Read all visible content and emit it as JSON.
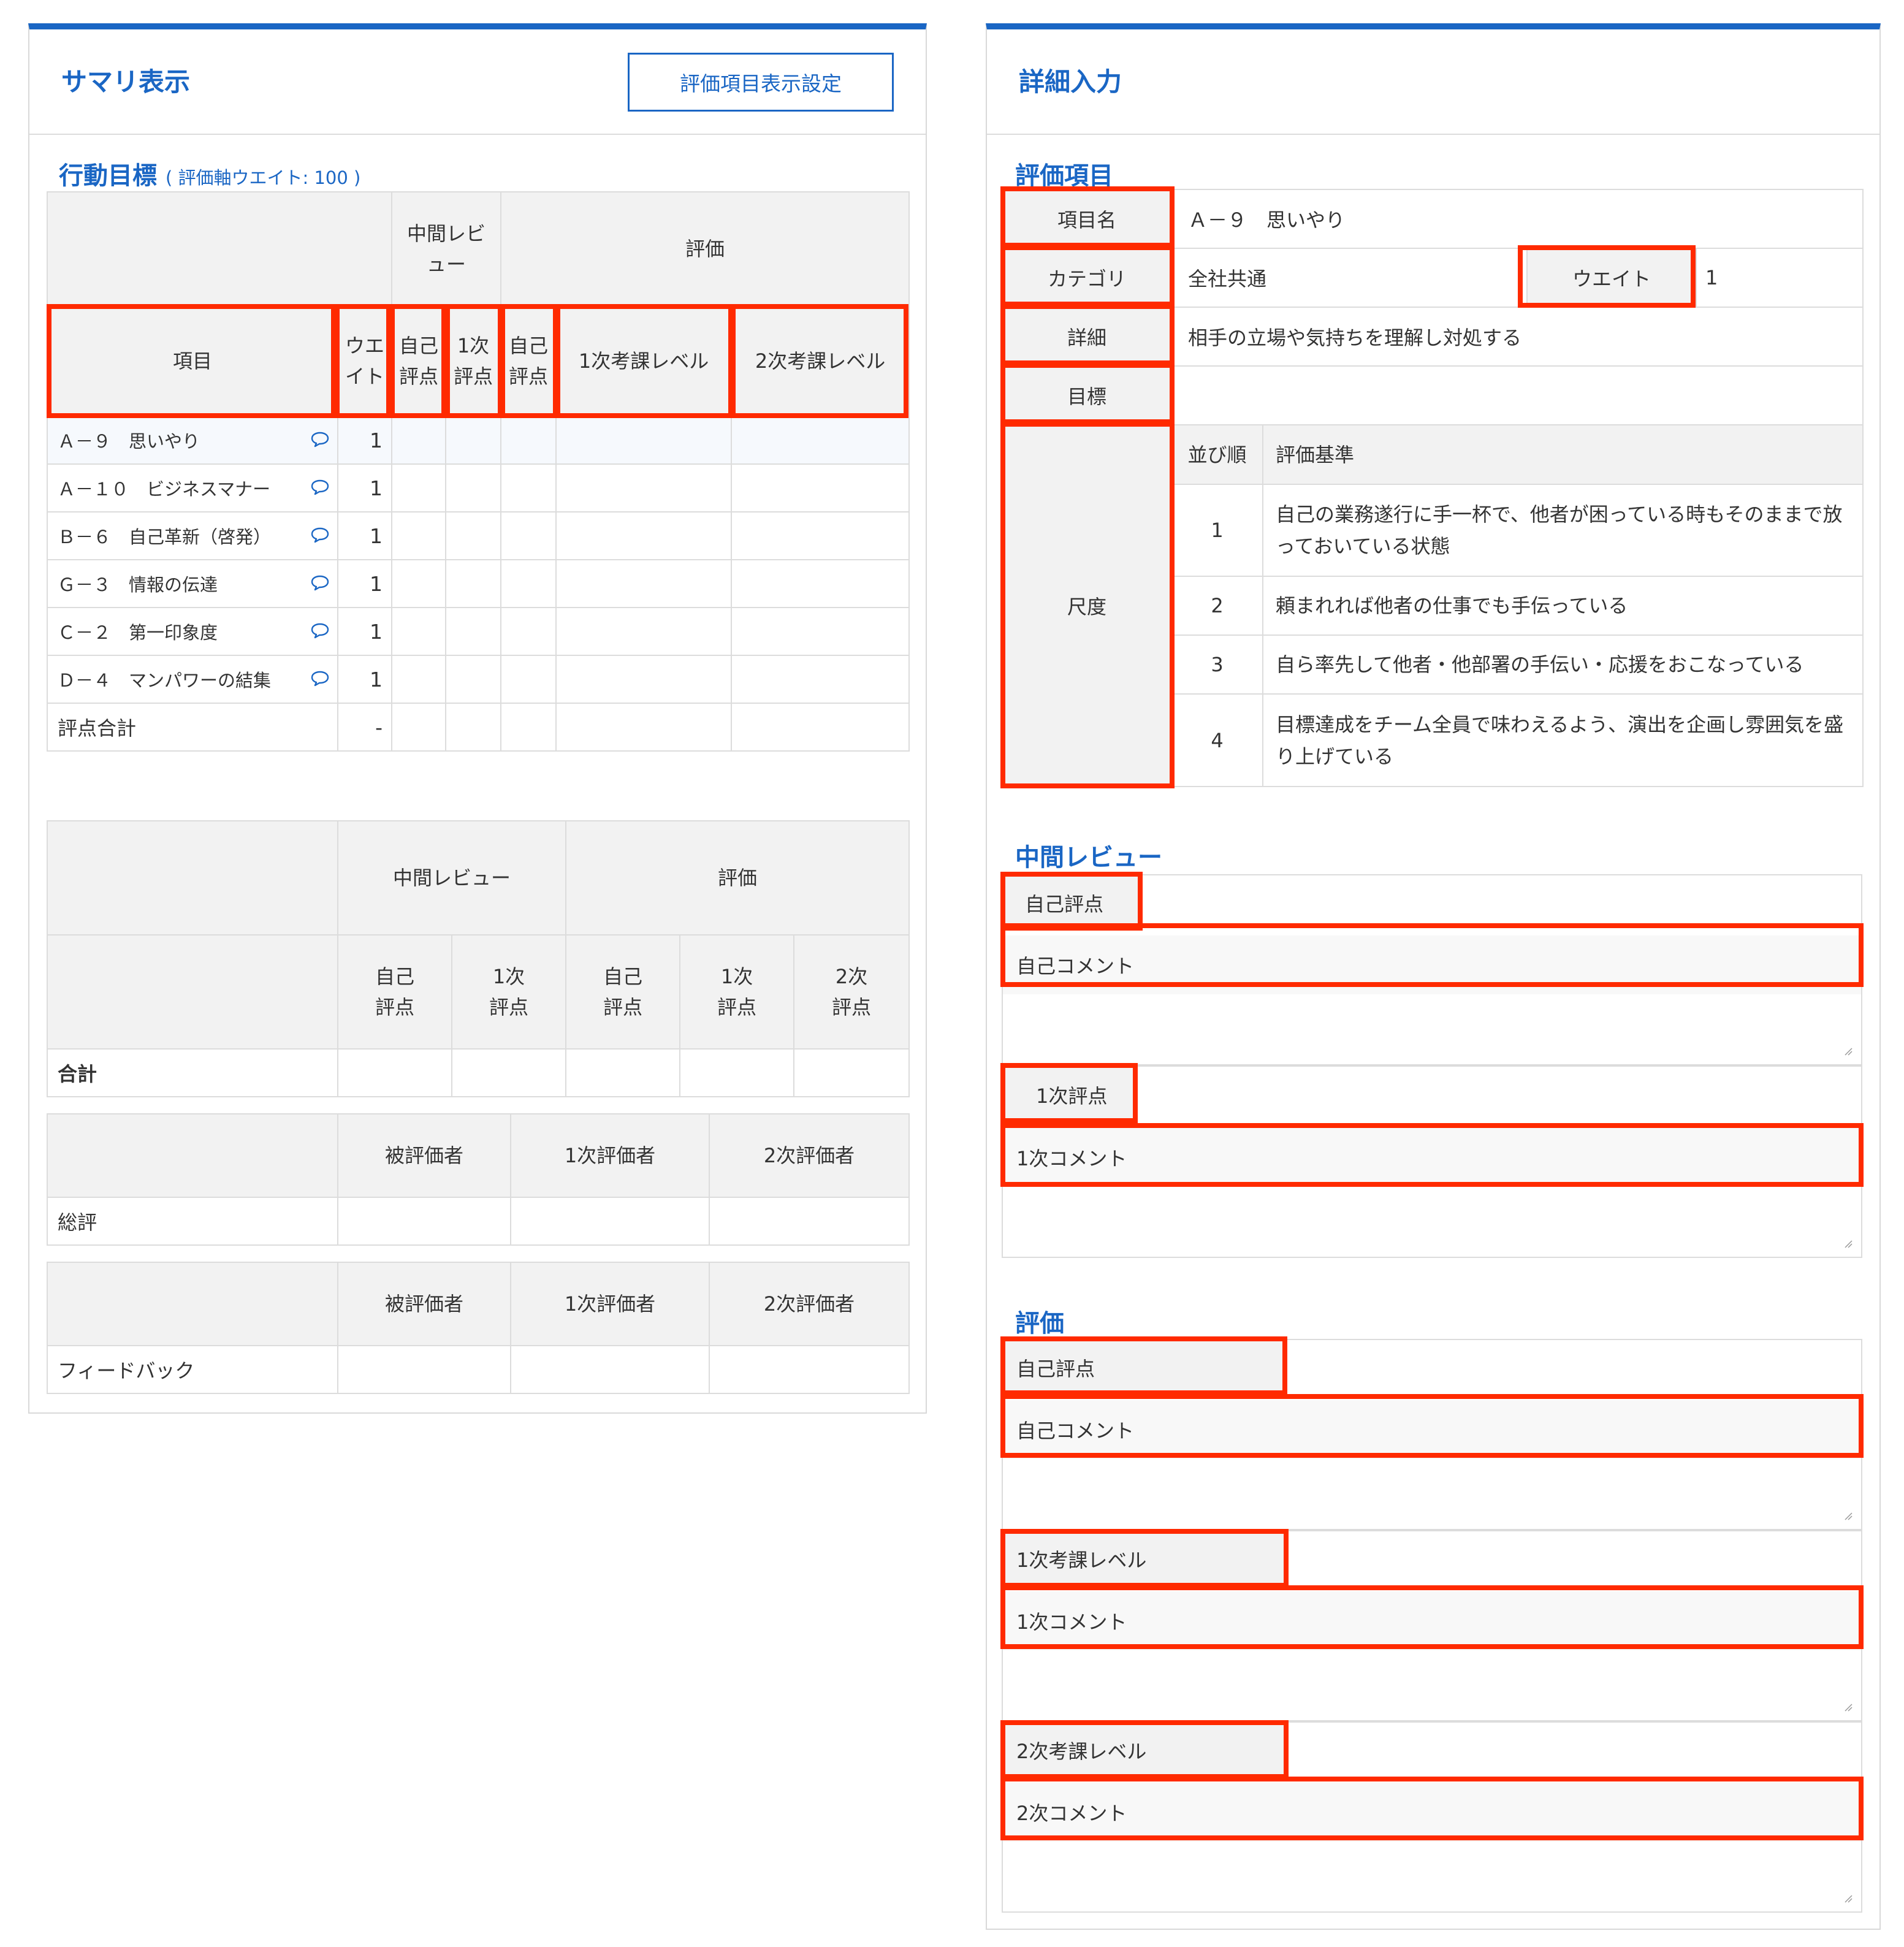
{
  "summary": {
    "title": "サマリ表示",
    "settings_button": "評価項目表示設定",
    "section_title": "行動目標",
    "section_weight": "( 評価軸ウエイト: 100 )",
    "table1": {
      "group_mid": "中間レビュー",
      "group_eval": "評価",
      "col_item": "項目",
      "col_weight": "ウエイト",
      "col_mid_self": "自己評点",
      "col_mid_first": "1次評点",
      "col_eval_self": "自己評点",
      "col_eval_first": "1次考課レベル",
      "col_eval_second": "2次考課レベル",
      "rows": [
        {
          "name": "Ａ－９　思いやり",
          "weight": "1"
        },
        {
          "name": "Ａ－１０　ビジネスマナー",
          "weight": "1"
        },
        {
          "name": "Ｂ－６　自己革新（啓発）",
          "weight": "1"
        },
        {
          "name": "Ｇ－３　情報の伝達",
          "weight": "1"
        },
        {
          "name": "Ｃ－２　第一印象度",
          "weight": "1"
        },
        {
          "name": "Ｄ－４　マンパワーの結集",
          "weight": "1"
        }
      ],
      "total_label": "評点合計",
      "total_value": "-"
    },
    "table2": {
      "group_mid": "中間レビュー",
      "group_eval": "評価",
      "col_mid_self": "自己評点",
      "col_mid_first": "1次評点",
      "col_eval_self": "自己評点",
      "col_eval_first": "1次評点",
      "col_eval_second": "2次評点",
      "total_label": "合計"
    },
    "table3": {
      "col1": "被評価者",
      "col2": "1次評価者",
      "col3": "2次評価者",
      "row_label": "総評"
    },
    "table4": {
      "col1": "被評価者",
      "col2": "1次評価者",
      "col3": "2次評価者",
      "row_label": "フィードバック"
    }
  },
  "detail": {
    "title": "詳細入力",
    "item_section": "評価項目",
    "item_name_label": "項目名",
    "item_name": "Ａ－９　思いやり",
    "category_label": "カテゴリ",
    "category": "全社共通",
    "weight_label": "ウエイト",
    "weight": "1",
    "detail_label": "詳細",
    "detail": "相手の立場や気持ちを理解し対処する",
    "goal_label": "目標",
    "goal": "",
    "scale_label": "尺度",
    "scale_header_order": "並び順",
    "scale_header_criteria": "評価基準",
    "scale": [
      {
        "order": "1",
        "criteria": "自己の業務遂行に手一杯で、他者が困っている時もそのままで放っておいている状態"
      },
      {
        "order": "2",
        "criteria": "頼まれれば他者の仕事でも手伝っている"
      },
      {
        "order": "3",
        "criteria": "自ら率先して他者・他部署の手伝い・応援をおこなっている"
      },
      {
        "order": "4",
        "criteria": "目標達成をチーム全員で味わえるよう、演出を企画し雰囲気を盛り上げている"
      }
    ],
    "mid_section": "中間レビュー",
    "mid_self_score": "自己評点",
    "mid_self_comment": "自己コメント",
    "mid_first_score": "1次評点",
    "mid_first_comment": "1次コメント",
    "eval_section": "評価",
    "eval_self_score": "自己評点",
    "eval_self_comment": "自己コメント",
    "eval_first_level": "1次考課レベル",
    "eval_first_comment": "1次コメント",
    "eval_second_level": "2次考課レベル",
    "eval_second_comment": "2次コメント"
  },
  "colors": {
    "accent": "#1a66c4",
    "highlight": "#ff2a00",
    "header_bg": "#f2f2f2"
  },
  "icons": {
    "comment": "speech-bubble-icon",
    "resize": "resize-handle-icon"
  }
}
